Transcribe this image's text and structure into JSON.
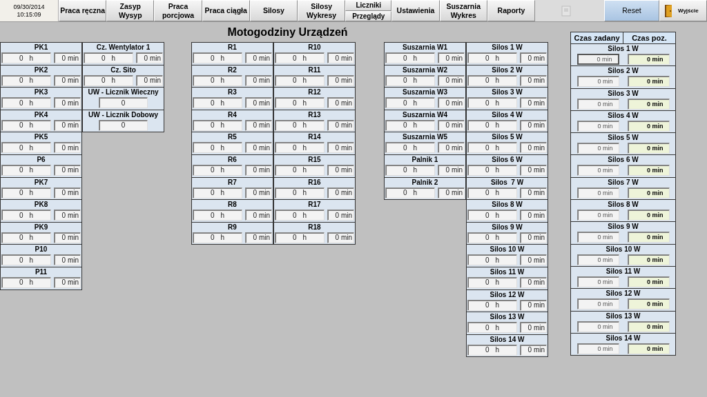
{
  "nav": [
    {
      "kind": "clock",
      "date": "09/30/2014",
      "time": "10:15:09"
    },
    {
      "kind": "button",
      "label": "Praca ręczna"
    },
    {
      "kind": "button",
      "label": "Zasyp\nWysyp"
    },
    {
      "kind": "button",
      "label": "Praca\nporcjowa"
    },
    {
      "kind": "button",
      "label": "Praca ciągła"
    },
    {
      "kind": "button",
      "label": "Silosy"
    },
    {
      "kind": "button",
      "label": "Silosy\nWykresy"
    },
    {
      "kind": "split",
      "labels": [
        "Liczniki",
        "Przeglądy"
      ]
    },
    {
      "kind": "button",
      "label": "Ustawienia"
    },
    {
      "kind": "button",
      "label": "Suszarnia\nWykres"
    },
    {
      "kind": "button",
      "label": "Raporty"
    }
  ],
  "actions": [
    {
      "kind": "reset",
      "label": "Reset"
    },
    {
      "kind": "exit",
      "label": "Wyjście"
    }
  ],
  "title": "Motogodziny Urządzeń",
  "groups": [
    {
      "columns": [
        [
          {
            "label": "PK1",
            "kind": "time",
            "hours": "0 h",
            "minutes": "0 min"
          },
          {
            "label": "PK2",
            "kind": "time",
            "hours": "0 h",
            "minutes": "0 min"
          },
          {
            "label": "PK3",
            "kind": "time",
            "hours": "0 h",
            "minutes": "0 min"
          },
          {
            "label": "PK4",
            "kind": "time",
            "hours": "0 h",
            "minutes": "0 min"
          },
          {
            "label": "PK5",
            "kind": "time",
            "hours": "0 h",
            "minutes": "0 min"
          },
          {
            "label": "P6",
            "kind": "time",
            "hours": "0 h",
            "minutes": "0 min"
          },
          {
            "label": "PK7",
            "kind": "time",
            "hours": "0 h",
            "minutes": "0 min"
          },
          {
            "label": "PK8",
            "kind": "time",
            "hours": "0 h",
            "minutes": "0 min"
          },
          {
            "label": "PK9",
            "kind": "time",
            "hours": "0 h",
            "minutes": "0 min"
          },
          {
            "label": "P10",
            "kind": "time",
            "hours": "0 h",
            "minutes": "0 min"
          },
          {
            "label": "P11",
            "kind": "time",
            "hours": "0 h",
            "minutes": "0 min"
          }
        ],
        [
          {
            "label": "Cz. Wentylator 1",
            "kind": "time",
            "hours": "0 h",
            "minutes": "0 min"
          },
          {
            "label": "Cz. Sito",
            "kind": "time",
            "hours": "0 h",
            "minutes": "0 min"
          },
          {
            "label": "UW - Licznik Wieczny",
            "kind": "counter",
            "value": "0"
          },
          {
            "label": "UW - Licznik Dobowy",
            "kind": "counter",
            "value": "0"
          }
        ]
      ]
    },
    {
      "columns": [
        [
          {
            "label": "R1",
            "kind": "time",
            "hours": "0 h",
            "minutes": "0 min"
          },
          {
            "label": "R2",
            "kind": "time",
            "hours": "0 h",
            "minutes": "0 min"
          },
          {
            "label": "R3",
            "kind": "time",
            "hours": "0 h",
            "minutes": "0 min"
          },
          {
            "label": "R4",
            "kind": "time",
            "hours": "0 h",
            "minutes": "0 min"
          },
          {
            "label": "R5",
            "kind": "time",
            "hours": "0 h",
            "minutes": "0 min"
          },
          {
            "label": "R6",
            "kind": "time",
            "hours": "0 h",
            "minutes": "0 min"
          },
          {
            "label": "R7",
            "kind": "time",
            "hours": "0 h",
            "minutes": "0 min"
          },
          {
            "label": "R8",
            "kind": "time",
            "hours": "0 h",
            "minutes": "0 min"
          },
          {
            "label": "R9",
            "kind": "time",
            "hours": "0 h",
            "minutes": "0 min"
          }
        ],
        [
          {
            "label": "R10",
            "kind": "time",
            "hours": "0 h",
            "minutes": "0 min"
          },
          {
            "label": "R11",
            "kind": "time",
            "hours": "0 h",
            "minutes": "0 min"
          },
          {
            "label": "R12",
            "kind": "time",
            "hours": "0 h",
            "minutes": "0 min"
          },
          {
            "label": "R13",
            "kind": "time",
            "hours": "0 h",
            "minutes": "0 min"
          },
          {
            "label": "R14",
            "kind": "time",
            "hours": "0 h",
            "minutes": "0 min"
          },
          {
            "label": "R15",
            "kind": "time",
            "hours": "0 h",
            "minutes": "0 min"
          },
          {
            "label": "R16",
            "kind": "time",
            "hours": "0 h",
            "minutes": "0 min"
          },
          {
            "label": "R17",
            "kind": "time",
            "hours": "0 h",
            "minutes": "0 min"
          },
          {
            "label": "R18",
            "kind": "time",
            "hours": "0 h",
            "minutes": "0 min"
          }
        ]
      ]
    },
    {
      "columns": [
        [
          {
            "label": "Suszarnia W1",
            "kind": "time",
            "hours": "0 h",
            "minutes": "0 min"
          },
          {
            "label": "Suszarnia W2",
            "kind": "time",
            "hours": "0 h",
            "minutes": "0 min"
          },
          {
            "label": "Suszarnia W3",
            "kind": "time",
            "hours": "0 h",
            "minutes": "0 min"
          },
          {
            "label": "Suszarnia W4",
            "kind": "time",
            "hours": "0 h",
            "minutes": "0 min"
          },
          {
            "label": "Suszarnia W5",
            "kind": "time",
            "hours": "0 h",
            "minutes": "0 min"
          },
          {
            "label": "Palnik 1",
            "kind": "time",
            "hours": "0 h",
            "minutes": "0 min"
          },
          {
            "label": "Palnik 2",
            "kind": "time",
            "hours": "0 h",
            "minutes": "0 min"
          }
        ],
        [
          {
            "label": "Silos 1 W",
            "kind": "time",
            "hours": "0 h",
            "minutes": "0 min"
          },
          {
            "label": "Silos 2 W",
            "kind": "time",
            "hours": "0 h",
            "minutes": "0 min"
          },
          {
            "label": "Silos 3 W",
            "kind": "time",
            "hours": "0 h",
            "minutes": "0 min"
          },
          {
            "label": "Silos 4 W",
            "kind": "time",
            "hours": "0 h",
            "minutes": "0 min"
          },
          {
            "label": "Silos 5 W",
            "kind": "time",
            "hours": "0 h",
            "minutes": "0 min"
          },
          {
            "label": "Silos 6 W",
            "kind": "time",
            "hours": "0 h",
            "minutes": "0 min"
          },
          {
            "label": "Silos  7 W",
            "kind": "time",
            "hours": "0 h",
            "minutes": "0 min"
          },
          {
            "label": "Silos 8 W",
            "kind": "time",
            "hours": "0 h",
            "minutes": "0 min"
          },
          {
            "label": "Silos 9 W",
            "kind": "time",
            "hours": "0 h",
            "minutes": "0 min"
          },
          {
            "label": "Silos 10 W",
            "kind": "time",
            "hours": "0 h",
            "minutes": "0 min"
          },
          {
            "label": "Silos 11 W",
            "kind": "time",
            "hours": "0 h",
            "minutes": "0 min"
          },
          {
            "label": "Silos 12 W",
            "kind": "time",
            "hours": "0 h",
            "minutes": "0 min"
          },
          {
            "label": "Silos 13 W",
            "kind": "time",
            "hours": "0 h",
            "minutes": "0 min"
          },
          {
            "label": "Silos 14 W",
            "kind": "time",
            "hours": "0 h",
            "minutes": "0 min"
          }
        ]
      ]
    }
  ],
  "timers": {
    "columns": [
      "Czas zadany",
      "Czas poz."
    ],
    "rows": [
      {
        "label": "Silos 1 W",
        "set": "0 min",
        "actual": "0 min",
        "selected": true
      },
      {
        "label": "Silos 2 W",
        "set": "0 min",
        "actual": "0 min",
        "selected": false
      },
      {
        "label": "Silos 3 W",
        "set": "0 min",
        "actual": "0 min",
        "selected": false
      },
      {
        "label": "Silos 4 W",
        "set": "0 min",
        "actual": "0 min",
        "selected": false
      },
      {
        "label": "Silos 5 W",
        "set": "0 min",
        "actual": "0 min",
        "selected": false
      },
      {
        "label": "Silos 6 W",
        "set": "0 min",
        "actual": "0 min",
        "selected": false
      },
      {
        "label": "Silos 7 W",
        "set": "0 min",
        "actual": "0 min",
        "selected": false
      },
      {
        "label": "Silos 8 W",
        "set": "0 min",
        "actual": "0 min",
        "selected": false
      },
      {
        "label": "Silos 9 W",
        "set": "0 min",
        "actual": "0 min",
        "selected": false
      },
      {
        "label": "Silos 10 W",
        "set": "0 min",
        "actual": "0 min",
        "selected": false
      },
      {
        "label": "Silos 11 W",
        "set": "0 min",
        "actual": "0 min",
        "selected": false
      },
      {
        "label": "Silos 12 W",
        "set": "0 min",
        "actual": "0 min",
        "selected": false
      },
      {
        "label": "Silos 13 W",
        "set": "0 min",
        "actual": "0 min",
        "selected": false
      },
      {
        "label": "Silos 14 W",
        "set": "0 min",
        "actual": "0 min",
        "selected": false
      }
    ]
  }
}
